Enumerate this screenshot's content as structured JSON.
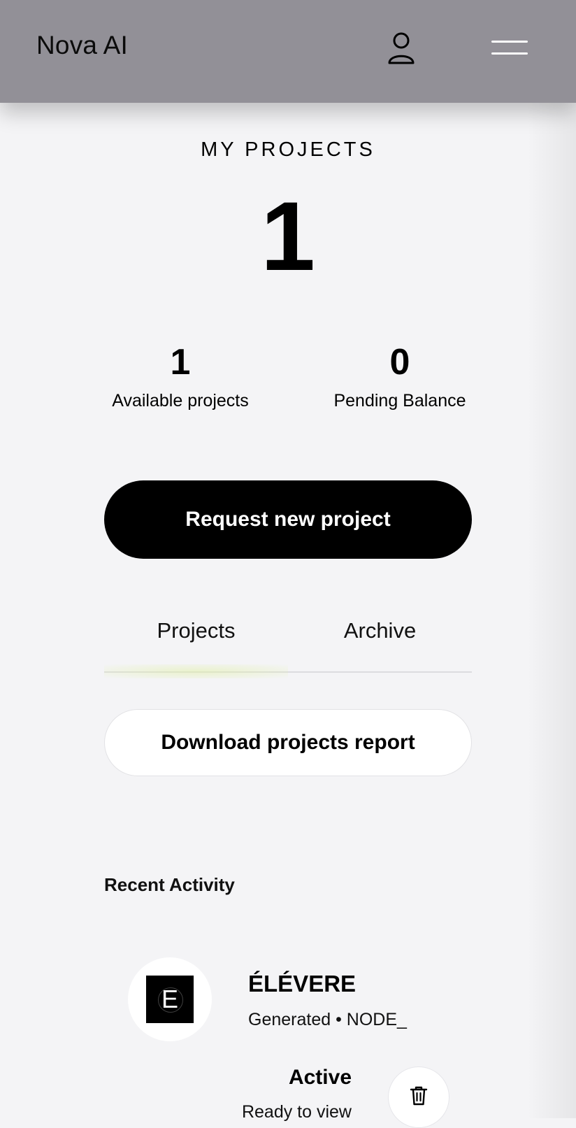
{
  "header": {
    "brand": "Nova AI",
    "icons": {
      "user": "user-icon",
      "menu": "hamburger-menu-icon"
    }
  },
  "summary": {
    "title": "MY PROJECTS",
    "total": "1",
    "available_value": "1",
    "available_label": "Available projects",
    "pending_value": "0",
    "pending_label": "Pending Balance"
  },
  "actions": {
    "request_label": "Request new project",
    "download_label": "Download projects report"
  },
  "tabs": [
    {
      "label": "Projects",
      "active": true
    },
    {
      "label": "Archive",
      "active": false
    }
  ],
  "activity": {
    "title": "Recent Activity",
    "items": [
      {
        "logo_letter": "E",
        "name": "ÉLÉVERE",
        "subtitle": "Generated • NODE_",
        "status": "Active",
        "note": "Ready to view",
        "delete_icon": "trash-icon"
      }
    ]
  },
  "colors": {
    "header_bg": "#929097",
    "page_bg": "#f4f4f6",
    "primary": "#000000",
    "tab_indicator": "#e1f0aa"
  }
}
